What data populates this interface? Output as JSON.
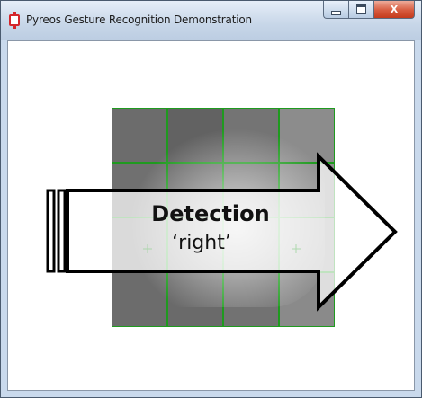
{
  "window": {
    "title": "Pyreos Gesture Recognition Demonstration",
    "accent_color": "#d4262b"
  },
  "caption_buttons": {
    "minimize_icon": "minimize-icon",
    "maximize_icon": "maximize-icon",
    "close_label": "X"
  },
  "grid": {
    "rows": 4,
    "cols": 4,
    "line_color": "#1f9a1f",
    "cell_colors": [
      [
        "#6c6c6c",
        "#626262",
        "#747474",
        "#8c8c8c"
      ],
      [
        "#707070",
        "#6a6a6a",
        "#767676",
        "#909090"
      ],
      [
        "#7a7a7a",
        "#7c7c7c",
        "#868686",
        "#9a9a9a"
      ],
      [
        "#6c6c6c",
        "#6a6a6a",
        "#727272",
        "#8a8a8a"
      ]
    ]
  },
  "detection": {
    "title": "Detection",
    "value": "‘right’",
    "arrow_icon": "right-arrow-icon"
  }
}
